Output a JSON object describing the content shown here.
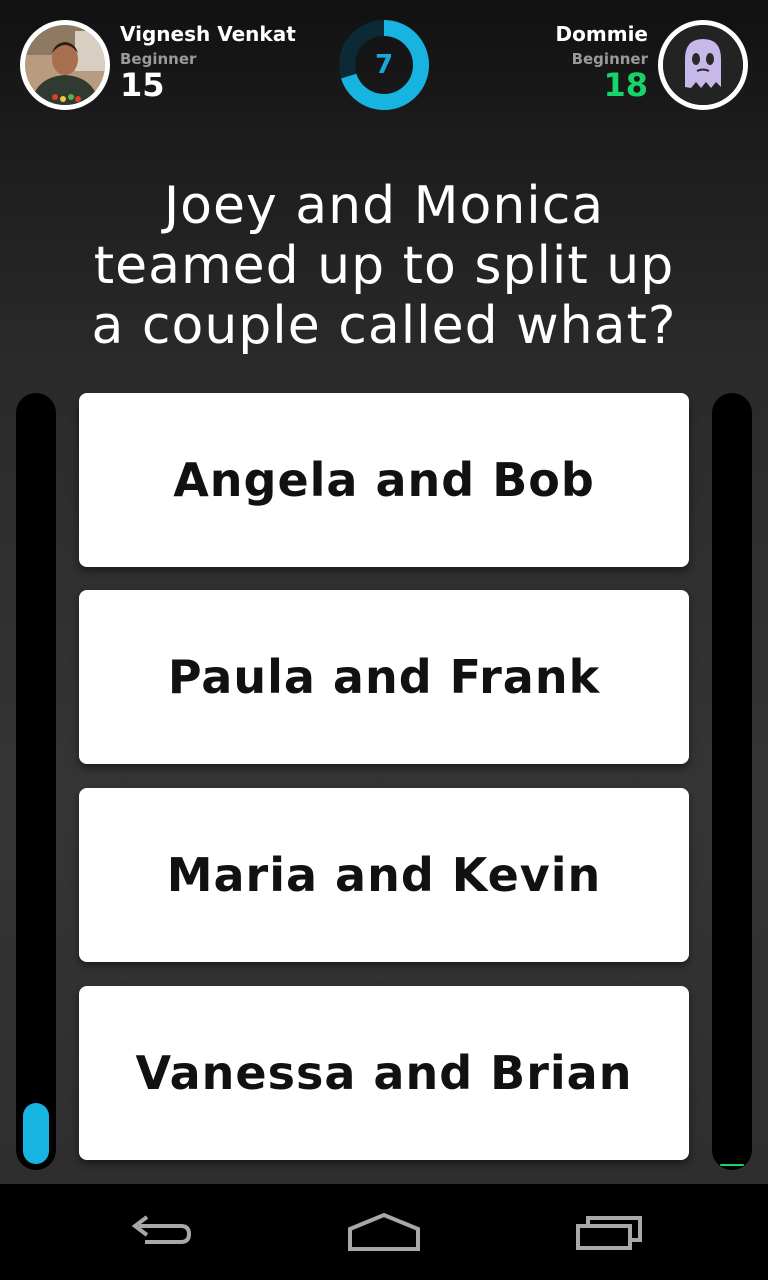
{
  "player_left": {
    "name": "Vignesh Venkat",
    "level": "Beginner",
    "score": "15",
    "time_fill": 0.08
  },
  "player_right": {
    "name": "Dommie",
    "level": "Beginner",
    "score": "18",
    "time_fill": 0.003
  },
  "timer": {
    "seconds": "7",
    "progress": 0.7
  },
  "question": {
    "lines": [
      "Joey and Monica",
      "teamed up to split up",
      "a couple called what?"
    ]
  },
  "answers": [
    {
      "label": "Angela and Bob"
    },
    {
      "label": "Paula and Frank"
    },
    {
      "label": "Maria and Kevin"
    },
    {
      "label": "Vanessa and Brian"
    }
  ],
  "colors": {
    "accent_blue": "#17b4e2",
    "score_green": "#17d46a",
    "timer_track": "#0c2a36"
  },
  "icons": {
    "nav_back": "back-arrow-icon",
    "nav_home": "home-icon",
    "nav_recents": "recent-apps-icon"
  }
}
